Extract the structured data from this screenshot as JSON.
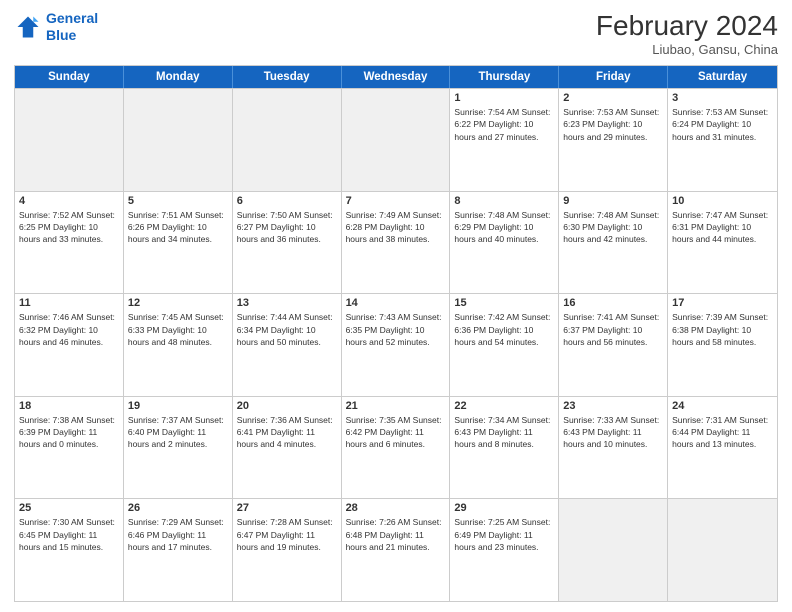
{
  "logo": {
    "line1": "General",
    "line2": "Blue"
  },
  "title": "February 2024",
  "subtitle": "Liubao, Gansu, China",
  "header_days": [
    "Sunday",
    "Monday",
    "Tuesday",
    "Wednesday",
    "Thursday",
    "Friday",
    "Saturday"
  ],
  "rows": [
    [
      {
        "day": "",
        "info": "",
        "shaded": true
      },
      {
        "day": "",
        "info": "",
        "shaded": true
      },
      {
        "day": "",
        "info": "",
        "shaded": true
      },
      {
        "day": "",
        "info": "",
        "shaded": true
      },
      {
        "day": "1",
        "info": "Sunrise: 7:54 AM\nSunset: 6:22 PM\nDaylight: 10 hours and 27 minutes."
      },
      {
        "day": "2",
        "info": "Sunrise: 7:53 AM\nSunset: 6:23 PM\nDaylight: 10 hours and 29 minutes."
      },
      {
        "day": "3",
        "info": "Sunrise: 7:53 AM\nSunset: 6:24 PM\nDaylight: 10 hours and 31 minutes."
      }
    ],
    [
      {
        "day": "4",
        "info": "Sunrise: 7:52 AM\nSunset: 6:25 PM\nDaylight: 10 hours and 33 minutes."
      },
      {
        "day": "5",
        "info": "Sunrise: 7:51 AM\nSunset: 6:26 PM\nDaylight: 10 hours and 34 minutes."
      },
      {
        "day": "6",
        "info": "Sunrise: 7:50 AM\nSunset: 6:27 PM\nDaylight: 10 hours and 36 minutes."
      },
      {
        "day": "7",
        "info": "Sunrise: 7:49 AM\nSunset: 6:28 PM\nDaylight: 10 hours and 38 minutes."
      },
      {
        "day": "8",
        "info": "Sunrise: 7:48 AM\nSunset: 6:29 PM\nDaylight: 10 hours and 40 minutes."
      },
      {
        "day": "9",
        "info": "Sunrise: 7:48 AM\nSunset: 6:30 PM\nDaylight: 10 hours and 42 minutes."
      },
      {
        "day": "10",
        "info": "Sunrise: 7:47 AM\nSunset: 6:31 PM\nDaylight: 10 hours and 44 minutes."
      }
    ],
    [
      {
        "day": "11",
        "info": "Sunrise: 7:46 AM\nSunset: 6:32 PM\nDaylight: 10 hours and 46 minutes."
      },
      {
        "day": "12",
        "info": "Sunrise: 7:45 AM\nSunset: 6:33 PM\nDaylight: 10 hours and 48 minutes."
      },
      {
        "day": "13",
        "info": "Sunrise: 7:44 AM\nSunset: 6:34 PM\nDaylight: 10 hours and 50 minutes."
      },
      {
        "day": "14",
        "info": "Sunrise: 7:43 AM\nSunset: 6:35 PM\nDaylight: 10 hours and 52 minutes."
      },
      {
        "day": "15",
        "info": "Sunrise: 7:42 AM\nSunset: 6:36 PM\nDaylight: 10 hours and 54 minutes."
      },
      {
        "day": "16",
        "info": "Sunrise: 7:41 AM\nSunset: 6:37 PM\nDaylight: 10 hours and 56 minutes."
      },
      {
        "day": "17",
        "info": "Sunrise: 7:39 AM\nSunset: 6:38 PM\nDaylight: 10 hours and 58 minutes."
      }
    ],
    [
      {
        "day": "18",
        "info": "Sunrise: 7:38 AM\nSunset: 6:39 PM\nDaylight: 11 hours and 0 minutes."
      },
      {
        "day": "19",
        "info": "Sunrise: 7:37 AM\nSunset: 6:40 PM\nDaylight: 11 hours and 2 minutes."
      },
      {
        "day": "20",
        "info": "Sunrise: 7:36 AM\nSunset: 6:41 PM\nDaylight: 11 hours and 4 minutes."
      },
      {
        "day": "21",
        "info": "Sunrise: 7:35 AM\nSunset: 6:42 PM\nDaylight: 11 hours and 6 minutes."
      },
      {
        "day": "22",
        "info": "Sunrise: 7:34 AM\nSunset: 6:43 PM\nDaylight: 11 hours and 8 minutes."
      },
      {
        "day": "23",
        "info": "Sunrise: 7:33 AM\nSunset: 6:43 PM\nDaylight: 11 hours and 10 minutes."
      },
      {
        "day": "24",
        "info": "Sunrise: 7:31 AM\nSunset: 6:44 PM\nDaylight: 11 hours and 13 minutes."
      }
    ],
    [
      {
        "day": "25",
        "info": "Sunrise: 7:30 AM\nSunset: 6:45 PM\nDaylight: 11 hours and 15 minutes."
      },
      {
        "day": "26",
        "info": "Sunrise: 7:29 AM\nSunset: 6:46 PM\nDaylight: 11 hours and 17 minutes."
      },
      {
        "day": "27",
        "info": "Sunrise: 7:28 AM\nSunset: 6:47 PM\nDaylight: 11 hours and 19 minutes."
      },
      {
        "day": "28",
        "info": "Sunrise: 7:26 AM\nSunset: 6:48 PM\nDaylight: 11 hours and 21 minutes."
      },
      {
        "day": "29",
        "info": "Sunrise: 7:25 AM\nSunset: 6:49 PM\nDaylight: 11 hours and 23 minutes."
      },
      {
        "day": "",
        "info": "",
        "shaded": true
      },
      {
        "day": "",
        "info": "",
        "shaded": true
      }
    ]
  ]
}
